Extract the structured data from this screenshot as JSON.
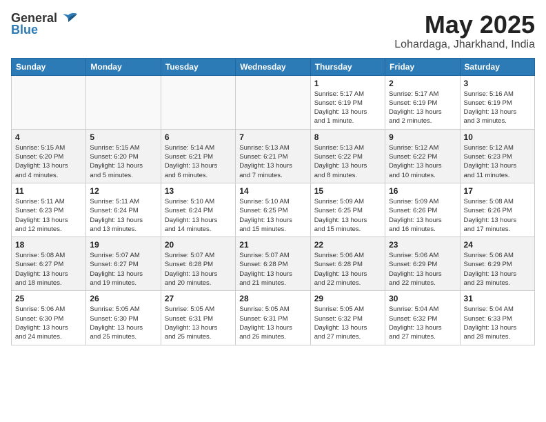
{
  "logo": {
    "general": "General",
    "blue": "Blue"
  },
  "title": "May 2025",
  "location": "Lohardaga, Jharkhand, India",
  "weekdays": [
    "Sunday",
    "Monday",
    "Tuesday",
    "Wednesday",
    "Thursday",
    "Friday",
    "Saturday"
  ],
  "weeks": [
    [
      {
        "day": "",
        "info": ""
      },
      {
        "day": "",
        "info": ""
      },
      {
        "day": "",
        "info": ""
      },
      {
        "day": "",
        "info": ""
      },
      {
        "day": "1",
        "info": "Sunrise: 5:17 AM\nSunset: 6:19 PM\nDaylight: 13 hours\nand 1 minute."
      },
      {
        "day": "2",
        "info": "Sunrise: 5:17 AM\nSunset: 6:19 PM\nDaylight: 13 hours\nand 2 minutes."
      },
      {
        "day": "3",
        "info": "Sunrise: 5:16 AM\nSunset: 6:19 PM\nDaylight: 13 hours\nand 3 minutes."
      }
    ],
    [
      {
        "day": "4",
        "info": "Sunrise: 5:15 AM\nSunset: 6:20 PM\nDaylight: 13 hours\nand 4 minutes."
      },
      {
        "day": "5",
        "info": "Sunrise: 5:15 AM\nSunset: 6:20 PM\nDaylight: 13 hours\nand 5 minutes."
      },
      {
        "day": "6",
        "info": "Sunrise: 5:14 AM\nSunset: 6:21 PM\nDaylight: 13 hours\nand 6 minutes."
      },
      {
        "day": "7",
        "info": "Sunrise: 5:13 AM\nSunset: 6:21 PM\nDaylight: 13 hours\nand 7 minutes."
      },
      {
        "day": "8",
        "info": "Sunrise: 5:13 AM\nSunset: 6:22 PM\nDaylight: 13 hours\nand 8 minutes."
      },
      {
        "day": "9",
        "info": "Sunrise: 5:12 AM\nSunset: 6:22 PM\nDaylight: 13 hours\nand 10 minutes."
      },
      {
        "day": "10",
        "info": "Sunrise: 5:12 AM\nSunset: 6:23 PM\nDaylight: 13 hours\nand 11 minutes."
      }
    ],
    [
      {
        "day": "11",
        "info": "Sunrise: 5:11 AM\nSunset: 6:23 PM\nDaylight: 13 hours\nand 12 minutes."
      },
      {
        "day": "12",
        "info": "Sunrise: 5:11 AM\nSunset: 6:24 PM\nDaylight: 13 hours\nand 13 minutes."
      },
      {
        "day": "13",
        "info": "Sunrise: 5:10 AM\nSunset: 6:24 PM\nDaylight: 13 hours\nand 14 minutes."
      },
      {
        "day": "14",
        "info": "Sunrise: 5:10 AM\nSunset: 6:25 PM\nDaylight: 13 hours\nand 15 minutes."
      },
      {
        "day": "15",
        "info": "Sunrise: 5:09 AM\nSunset: 6:25 PM\nDaylight: 13 hours\nand 15 minutes."
      },
      {
        "day": "16",
        "info": "Sunrise: 5:09 AM\nSunset: 6:26 PM\nDaylight: 13 hours\nand 16 minutes."
      },
      {
        "day": "17",
        "info": "Sunrise: 5:08 AM\nSunset: 6:26 PM\nDaylight: 13 hours\nand 17 minutes."
      }
    ],
    [
      {
        "day": "18",
        "info": "Sunrise: 5:08 AM\nSunset: 6:27 PM\nDaylight: 13 hours\nand 18 minutes."
      },
      {
        "day": "19",
        "info": "Sunrise: 5:07 AM\nSunset: 6:27 PM\nDaylight: 13 hours\nand 19 minutes."
      },
      {
        "day": "20",
        "info": "Sunrise: 5:07 AM\nSunset: 6:28 PM\nDaylight: 13 hours\nand 20 minutes."
      },
      {
        "day": "21",
        "info": "Sunrise: 5:07 AM\nSunset: 6:28 PM\nDaylight: 13 hours\nand 21 minutes."
      },
      {
        "day": "22",
        "info": "Sunrise: 5:06 AM\nSunset: 6:28 PM\nDaylight: 13 hours\nand 22 minutes."
      },
      {
        "day": "23",
        "info": "Sunrise: 5:06 AM\nSunset: 6:29 PM\nDaylight: 13 hours\nand 22 minutes."
      },
      {
        "day": "24",
        "info": "Sunrise: 5:06 AM\nSunset: 6:29 PM\nDaylight: 13 hours\nand 23 minutes."
      }
    ],
    [
      {
        "day": "25",
        "info": "Sunrise: 5:06 AM\nSunset: 6:30 PM\nDaylight: 13 hours\nand 24 minutes."
      },
      {
        "day": "26",
        "info": "Sunrise: 5:05 AM\nSunset: 6:30 PM\nDaylight: 13 hours\nand 25 minutes."
      },
      {
        "day": "27",
        "info": "Sunrise: 5:05 AM\nSunset: 6:31 PM\nDaylight: 13 hours\nand 25 minutes."
      },
      {
        "day": "28",
        "info": "Sunrise: 5:05 AM\nSunset: 6:31 PM\nDaylight: 13 hours\nand 26 minutes."
      },
      {
        "day": "29",
        "info": "Sunrise: 5:05 AM\nSunset: 6:32 PM\nDaylight: 13 hours\nand 27 minutes."
      },
      {
        "day": "30",
        "info": "Sunrise: 5:04 AM\nSunset: 6:32 PM\nDaylight: 13 hours\nand 27 minutes."
      },
      {
        "day": "31",
        "info": "Sunrise: 5:04 AM\nSunset: 6:33 PM\nDaylight: 13 hours\nand 28 minutes."
      }
    ]
  ]
}
